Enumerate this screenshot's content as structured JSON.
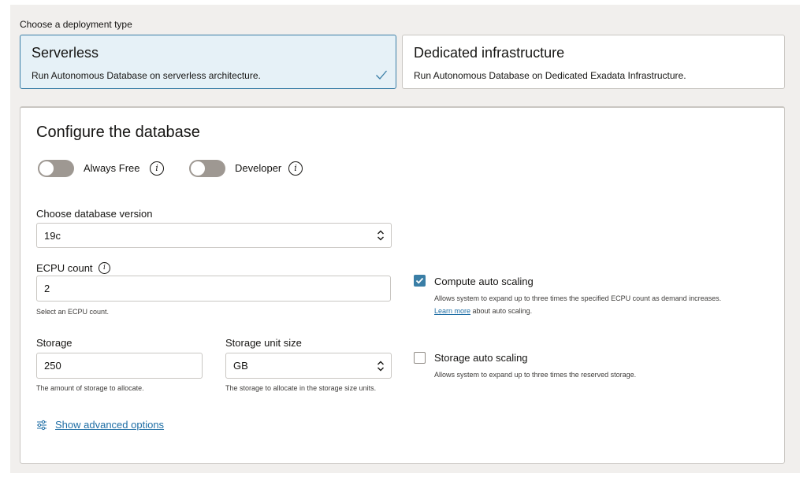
{
  "deployment": {
    "label": "Choose a deployment type",
    "options": [
      {
        "title": "Serverless",
        "description": "Run Autonomous Database on serverless architecture.",
        "selected": true
      },
      {
        "title": "Dedicated infrastructure",
        "description": "Run Autonomous Database on Dedicated Exadata Infrastructure.",
        "selected": false
      }
    ]
  },
  "config": {
    "title": "Configure the database",
    "toggles": [
      {
        "label": "Always Free",
        "on": false
      },
      {
        "label": "Developer",
        "on": false
      }
    ],
    "db_version": {
      "label": "Choose database version",
      "value": "19c"
    },
    "ecpu": {
      "label": "ECPU count",
      "value": "2",
      "help": "Select an ECPU count."
    },
    "storage": {
      "label": "Storage",
      "value": "250",
      "help": "The amount of storage to allocate."
    },
    "storage_unit": {
      "label": "Storage unit size",
      "value": "GB",
      "help": "The storage to allocate in the storage size units."
    },
    "compute_auto_scaling": {
      "label": "Compute auto scaling",
      "checked": true,
      "description": "Allows system to expand up to three times the specified ECPU count as demand increases.",
      "link_text": "Learn more",
      "link_suffix": " about auto scaling."
    },
    "storage_auto_scaling": {
      "label": "Storage auto scaling",
      "checked": false,
      "description": "Allows system to expand up to three times the reserved storage."
    },
    "advanced_link": "Show advanced options",
    "icons": {
      "info": "info-icon",
      "check": "checkmark-icon",
      "chevron": "up-down-chevron-icon",
      "sliders": "sliders-icon"
    },
    "colors": {
      "accent": "#3a7ea6",
      "link": "#1f6ea5",
      "selected_bg": "#e6f1f7"
    }
  }
}
